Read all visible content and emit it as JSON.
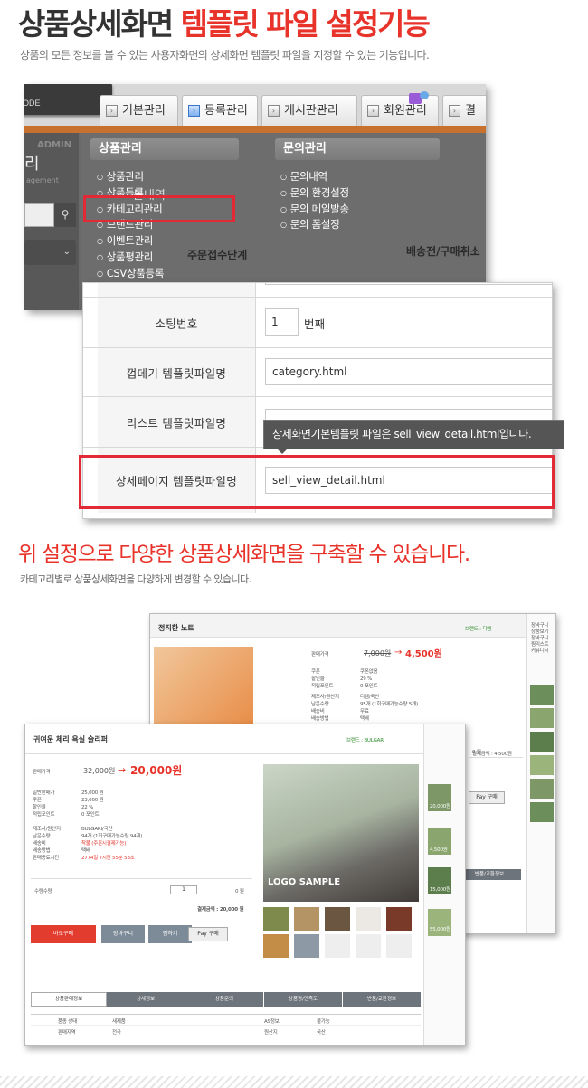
{
  "header": {
    "title_plain": "상품상세화면 ",
    "title_red": "템플릿 파일 설정기능",
    "subtitle": "상품의 모든 정보를 볼 수 있는 사용자화면의 상세화면 템플릿 파일을 지정할 수 있는 기능입니다."
  },
  "admin": {
    "logo_text": "ODE",
    "tabs": [
      "기본관리",
      "등록관리",
      "게시판관리",
      "회원관리",
      "결"
    ],
    "active_tab": "등록관리",
    "side_admin": "ADMIN",
    "side_ri": "리",
    "side_mgt": "agement",
    "menu1_title": "상품관리",
    "menu1_items": [
      "상품관리",
      "상품등록",
      "카테고리관리",
      "브랜드관리",
      "이벤트관리",
      "상품평관리",
      "CSV상품등록"
    ],
    "menu2_title": "문의관리",
    "menu2_items": [
      "문의내역",
      "문의 환경설정",
      "문의 메일발송",
      "문의 폼설정"
    ],
    "ghost_text": "문내역",
    "content_title1": "주문접수단계",
    "content_title2": "배송전/구매취소"
  },
  "form": {
    "rows": [
      {
        "label": "소팅번호",
        "value": "1",
        "unit": "번째"
      },
      {
        "label": "껍데기 템플릿파일명",
        "value": "category.html"
      },
      {
        "label": "리스트 템플릿파일명",
        "value": ""
      },
      {
        "label": "상세페이지 템플릿파일명",
        "value": "sell_view_detail.html"
      }
    ],
    "tooltip": "상세화면기본템플릿 파일은 sell_view_detail.html입니다."
  },
  "section2": {
    "title": "위 설정으로 다양한 상품상세화면을 구축할 수 있습니다.",
    "subtitle": "카테고리별로 상품상세화면을 다양하게 변경할 수 있습니다."
  },
  "back_product": {
    "name": "정직한 노트",
    "brand": "브랜드 : 디엠",
    "price_label": "판매가격",
    "price_old": "7,000원",
    "price_new": "4,500원",
    "total": "결제금액 : 4,500원",
    "npay": "Pay 구매",
    "side_links": [
      "장바구니",
      "상품보기",
      "장바구니",
      "찜리스트",
      "커뮤니티"
    ],
    "info_rows": [
      {
        "k": "쿠폰",
        "v": "쿠폰없음"
      },
      {
        "k": "할인율",
        "v": "29 %"
      },
      {
        "k": "적립포인트",
        "v": "0 포인트"
      },
      {
        "k": "제조사/원산지",
        "v": "디엠/국산"
      },
      {
        "k": "남은수량",
        "v": "95개 (1회구매가능수량 5개)"
      },
      {
        "k": "배송비",
        "v": "무료"
      },
      {
        "k": "배송방법",
        "v": "택배"
      }
    ],
    "tab_label": "반품/교환정보"
  },
  "front_product": {
    "name": "귀여운 체리 욕실 슬리퍼",
    "brand": "브랜드 : BULGARI",
    "price_label": "판매가격",
    "price_old": "32,000원",
    "price_new": "20,000원",
    "info_rows": [
      {
        "k": "일반판매가",
        "v": "25,000 원"
      },
      {
        "k": "쿠폰",
        "v": "23,000 원"
      },
      {
        "k": "할인율",
        "v": "22 %"
      },
      {
        "k": "적립포인트",
        "v": "0 포인트"
      },
      {
        "k": "제조사/원산지",
        "v": "BULGARI/국산"
      },
      {
        "k": "남은수량",
        "v": "94개 (1회구매가능수량 94개)"
      },
      {
        "k": "배송비",
        "v": "착불 (주문시결제가능)"
      },
      {
        "k": "배송방법",
        "v": "택배"
      },
      {
        "k": "판매종료시간",
        "v": "2774일 7시간 55분 53초"
      }
    ],
    "qty_label": "수량수량",
    "qty_value": "1",
    "qty_price": "0 원",
    "total": "결제금액 : 20,000 원",
    "buttons": [
      "바로구매",
      "장바구니",
      "찜하기",
      "Pay 구매"
    ],
    "logo_sample": "LOGO SAMPLE",
    "tabs": [
      "상품판매정보",
      "상세정보",
      "상품문의",
      "상품평/만족도",
      "반품/교환정보"
    ],
    "table": [
      {
        "k1": "품종 상태",
        "v1": "새제품",
        "k2": "AS정보",
        "v2": "불가능"
      },
      {
        "k1": "판매지역",
        "v1": "전국",
        "k2": "원산지",
        "v2": "국산"
      }
    ],
    "side_prices": [
      "20,000원",
      "4,500원",
      "15,000원",
      "55,000원"
    ]
  }
}
